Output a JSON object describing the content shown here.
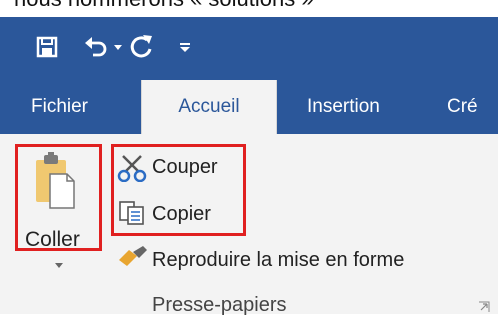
{
  "caption": "nous nommerons « solutions »",
  "quick_access": {
    "save_icon": "save-icon",
    "undo_icon": "undo-icon",
    "undo_dropdown_icon": "chevron-down-icon",
    "redo_icon": "redo-icon",
    "customize_icon": "customize-qat-icon"
  },
  "tabs": [
    {
      "label": "Fichier",
      "active": false
    },
    {
      "label": "Accueil",
      "active": true
    },
    {
      "label": "Insertion",
      "active": false
    },
    {
      "label": "Cré",
      "active": false
    }
  ],
  "clipboard": {
    "paste_label": "Coller",
    "cut_label": "Couper",
    "copy_label": "Copier",
    "format_painter_label": "Reproduire la mise en forme",
    "group_label": "Presse-papiers"
  },
  "colors": {
    "ribbon_blue": "#2b579a",
    "highlight_red": "#e02020",
    "ribbon_bg": "#f3f3f3"
  }
}
